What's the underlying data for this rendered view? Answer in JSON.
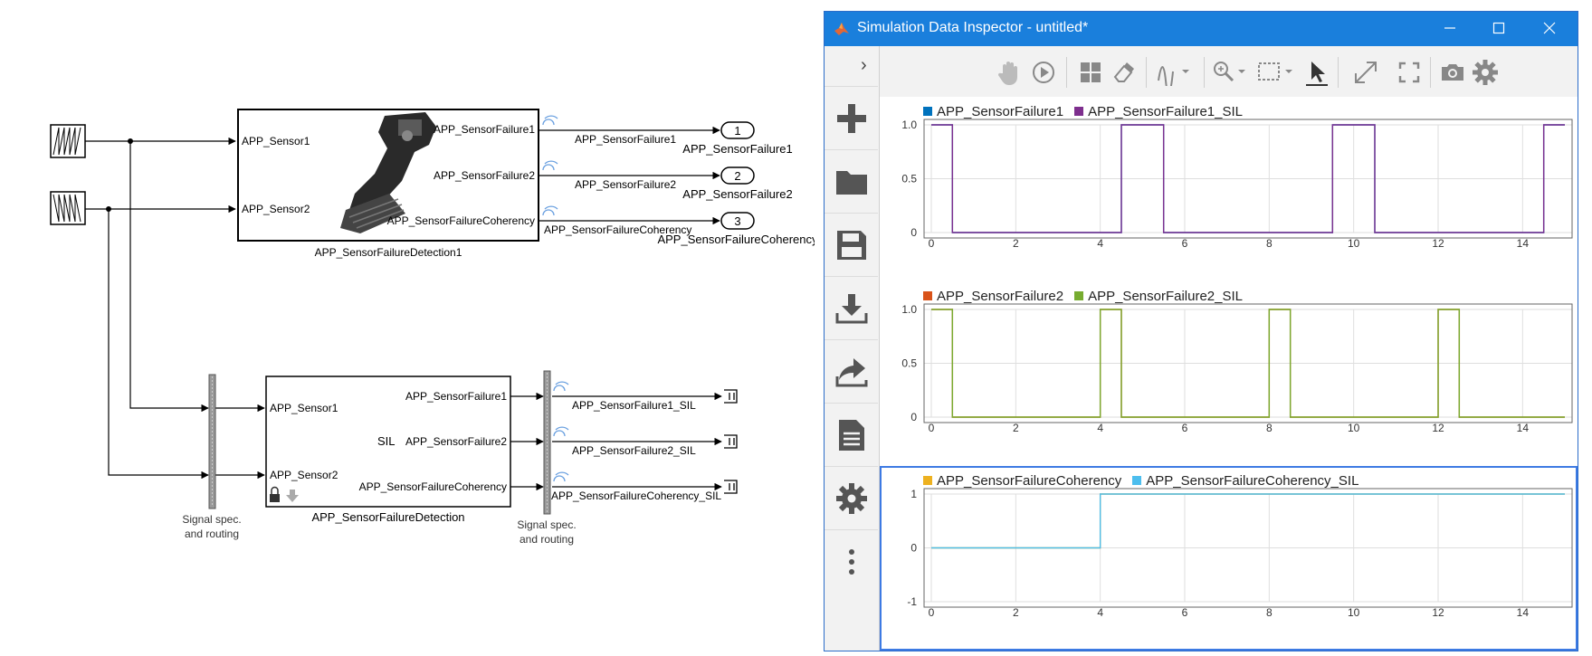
{
  "diagram": {
    "top_block": {
      "name": "APP_SensorFailureDetection1",
      "inputs": [
        "APP_Sensor1",
        "APP_Sensor2"
      ],
      "outputs": [
        "APP_SensorFailure1",
        "APP_SensorFailure2",
        "APP_SensorFailureCoherency"
      ]
    },
    "top_signals": [
      "APP_SensorFailure1",
      "APP_SensorFailure2",
      "APP_SensorFailureCoherency"
    ],
    "outports": [
      {
        "num": "1",
        "name": "APP_SensorFailure1"
      },
      {
        "num": "2",
        "name": "APP_SensorFailure2"
      },
      {
        "num": "3",
        "name": "APP_SensorFailureCoherency"
      }
    ],
    "bottom_block": {
      "name": "APP_SensorFailureDetection",
      "tag": "SIL",
      "inputs": [
        "APP_Sensor1",
        "APP_Sensor2"
      ],
      "outputs": [
        "APP_SensorFailure1",
        "APP_SensorFailure2",
        "APP_SensorFailureCoherency"
      ]
    },
    "bottom_signals": [
      "APP_SensorFailure1_SIL",
      "APP_SensorFailure2_SIL",
      "APP_SensorFailureCoherency_SIL"
    ],
    "routing_label_1": "Signal spec.",
    "routing_label_2": "and routing"
  },
  "sdi": {
    "title": "Simulation Data Inspector - untitled*",
    "leftbar_icons": [
      "add-icon",
      "folder-icon",
      "save-icon",
      "import-icon",
      "share-icon",
      "report-icon",
      "settings-icon",
      "more-icon"
    ],
    "toolbar_icons": [
      "pan-icon",
      "replay-icon",
      "layout-icon",
      "erase-icon",
      "signal-icon",
      "zoom-icon",
      "fit-icon",
      "cursor-icon",
      "expand-icon",
      "fullscreen-icon",
      "camera-icon",
      "gear-icon"
    ]
  },
  "chart_data": [
    {
      "type": "line",
      "series": [
        {
          "name": "APP_SensorFailure1",
          "color": "#0072bd",
          "x": [
            0,
            0.5,
            0.5,
            4.5,
            4.5,
            5.5,
            5.5,
            9.5,
            9.5,
            10.5,
            10.5,
            14.5,
            14.5,
            15
          ],
          "values": [
            1,
            1,
            0,
            0,
            1,
            1,
            0,
            0,
            1,
            1,
            0,
            0,
            1,
            1
          ]
        },
        {
          "name": "APP_SensorFailure1_SIL",
          "color": "#7e2f8e",
          "x": [
            0,
            0.5,
            0.5,
            4.5,
            4.5,
            5.5,
            5.5,
            9.5,
            9.5,
            10.5,
            10.5,
            14.5,
            14.5,
            15
          ],
          "values": [
            1,
            1,
            0,
            0,
            1,
            1,
            0,
            0,
            1,
            1,
            0,
            0,
            1,
            1
          ]
        }
      ],
      "xlim": [
        0,
        15
      ],
      "ylim": [
        0,
        1
      ],
      "xticks": [
        "0",
        "2",
        "4",
        "6",
        "8",
        "10",
        "12",
        "14"
      ],
      "yticks": [
        "0",
        "0.5",
        "1.0"
      ]
    },
    {
      "type": "line",
      "series": [
        {
          "name": "APP_SensorFailure2",
          "color": "#d95319",
          "x": [
            0,
            0.5,
            0.5,
            4,
            4,
            4.5,
            4.5,
            8,
            8,
            8.5,
            8.5,
            12,
            12,
            12.5,
            12.5,
            15
          ],
          "values": [
            1,
            1,
            0,
            0,
            1,
            1,
            0,
            0,
            1,
            1,
            0,
            0,
            1,
            1,
            0,
            0
          ]
        },
        {
          "name": "APP_SensorFailure2_SIL",
          "color": "#77ac30",
          "x": [
            0,
            0.5,
            0.5,
            4,
            4,
            4.5,
            4.5,
            8,
            8,
            8.5,
            8.5,
            12,
            12,
            12.5,
            12.5,
            15
          ],
          "values": [
            1,
            1,
            0,
            0,
            1,
            1,
            0,
            0,
            1,
            1,
            0,
            0,
            1,
            1,
            0,
            0
          ]
        }
      ],
      "xlim": [
        0,
        15
      ],
      "ylim": [
        0,
        1
      ],
      "xticks": [
        "0",
        "2",
        "4",
        "6",
        "8",
        "10",
        "12",
        "14"
      ],
      "yticks": [
        "0",
        "0.5",
        "1.0"
      ]
    },
    {
      "type": "line",
      "series": [
        {
          "name": "APP_SensorFailureCoherency",
          "color": "#edb120",
          "x": [
            0,
            4,
            4,
            15
          ],
          "values": [
            0,
            0,
            1,
            1
          ]
        },
        {
          "name": "APP_SensorFailureCoherency_SIL",
          "color": "#4dbeee",
          "x": [
            0,
            4,
            4,
            15
          ],
          "values": [
            0,
            0,
            1,
            1
          ]
        }
      ],
      "xlim": [
        0,
        15
      ],
      "ylim": [
        -1,
        1
      ],
      "xticks": [
        "0",
        "2",
        "4",
        "6",
        "8",
        "10",
        "12",
        "14"
      ],
      "yticks": [
        "-1",
        "0",
        "1"
      ]
    }
  ]
}
